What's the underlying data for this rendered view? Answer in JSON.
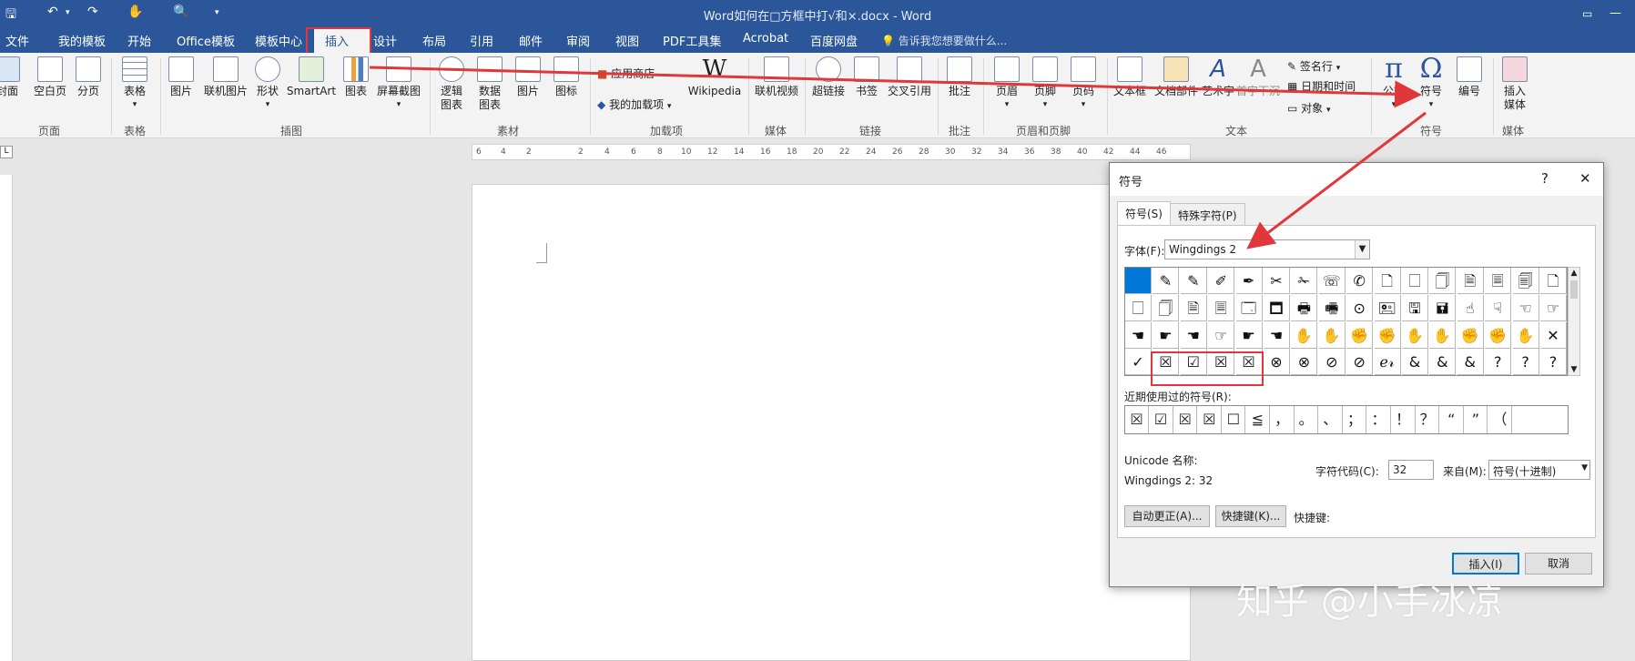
{
  "window": {
    "title": "Word如何在□方框中打√和×.docx - Word"
  },
  "tabs": [
    "文件",
    "我的模板",
    "开始",
    "Office模板",
    "模板中心",
    "插入",
    "设计",
    "布局",
    "引用",
    "邮件",
    "审阅",
    "视图",
    "PDF工具集",
    "Acrobat",
    "百度网盘"
  ],
  "tell_me": "告诉我您想要做什么...",
  "ribbon": {
    "groups": [
      "页面",
      "表格",
      "插图",
      "素材",
      "加载项",
      "媒体",
      "链接",
      "批注",
      "页眉和页脚",
      "文本",
      "符号",
      "媒体"
    ],
    "buttons": {
      "cover": "封面",
      "blank": "空白页",
      "pagebreak": "分页",
      "table": "表格",
      "picture": "图片",
      "online_picture": "联机图片",
      "shapes": "形状",
      "smartart": "SmartArt",
      "chart": "图表",
      "screenshot": "屏幕截图",
      "logic1": "逻辑",
      "logic2": "图表",
      "data1": "数据",
      "data2": "图表",
      "img": "图片",
      "icon": "图标",
      "store": "应用商店",
      "my_addins": "我的加载项",
      "wikipedia": "Wikipedia",
      "online_video": "联机视频",
      "hyperlink": "超链接",
      "bookmark": "书签",
      "crossref": "交叉引用",
      "comment": "批注",
      "header": "页眉",
      "footer": "页脚",
      "pagenum": "页码",
      "textbox": "文本框",
      "docparts": "文档部件",
      "wordart": "艺术字",
      "dropcap": "首字下沉",
      "signature": "签名行",
      "datetime": "日期和时间",
      "object": "对象",
      "equation": "公式",
      "symbol": "符号",
      "number": "编号",
      "insert_media1": "插入",
      "insert_media2": "媒体"
    }
  },
  "ruler": [
    "6",
    "4",
    "2",
    "2",
    "4",
    "6",
    "8",
    "10",
    "12",
    "14",
    "16",
    "18",
    "20",
    "22",
    "24",
    "26",
    "28",
    "30",
    "32",
    "34",
    "36",
    "38",
    "40",
    "42",
    "44",
    "46"
  ],
  "dialog": {
    "title": "符号",
    "help": "?",
    "close": "✕",
    "tab_symbols": "符号(S)",
    "tab_special": "特殊字符(P)",
    "font_label": "字体(F):",
    "font_value": "Wingdings 2",
    "symbols": [
      " ",
      "✎",
      "✎",
      "✐",
      "✒",
      "✂",
      "✁",
      "☏",
      "✆",
      "🗋",
      "🗌",
      "🗍",
      "🗎",
      "🗏",
      "🗐",
      "🗋",
      "🗌",
      "🗍",
      "🗎",
      "🗏",
      "🗔",
      "🗖",
      "🖶",
      "🖷",
      "⊙",
      "🖭",
      "🖫",
      "🖬",
      "☝",
      "☟",
      "☜",
      "☞",
      "☚",
      "☛",
      "☚",
      "☞",
      "☛",
      "☚",
      "✋",
      "✋",
      "✊",
      "✊",
      "✋",
      "✋",
      "✊",
      "✊",
      "✋",
      "✕",
      "✓",
      "☒",
      "☑",
      "☒",
      "☒",
      "⊗",
      "⊗",
      "⊘",
      "⊘",
      "ℯ𝓇",
      "&",
      "&",
      "&",
      "?",
      "?",
      "?"
    ],
    "recent_label": "近期使用过的符号(R):",
    "recent": [
      "☒",
      "☑",
      "☒",
      "☒",
      "☐",
      "≦",
      "，",
      "。",
      "、",
      "；",
      "：",
      "！",
      "？",
      "“",
      "”",
      "（"
    ],
    "unicode_label": "Unicode 名称:",
    "unicode_value": "Wingdings 2: 32",
    "charcode_label": "字符代码(C):",
    "charcode_value": "32",
    "from_label": "来自(M):",
    "from_value": "符号(十进制)",
    "autocorrect": "自动更正(A)...",
    "shortcut_btn": "快捷键(K)...",
    "shortcut_label": "快捷键:",
    "insert": "插入(I)",
    "cancel": "取消"
  },
  "watermark": "知乎 @小手冰凉",
  "colors": {
    "accent": "#2b579a",
    "highlight": "#e0383a",
    "selection": "#0078d7"
  }
}
